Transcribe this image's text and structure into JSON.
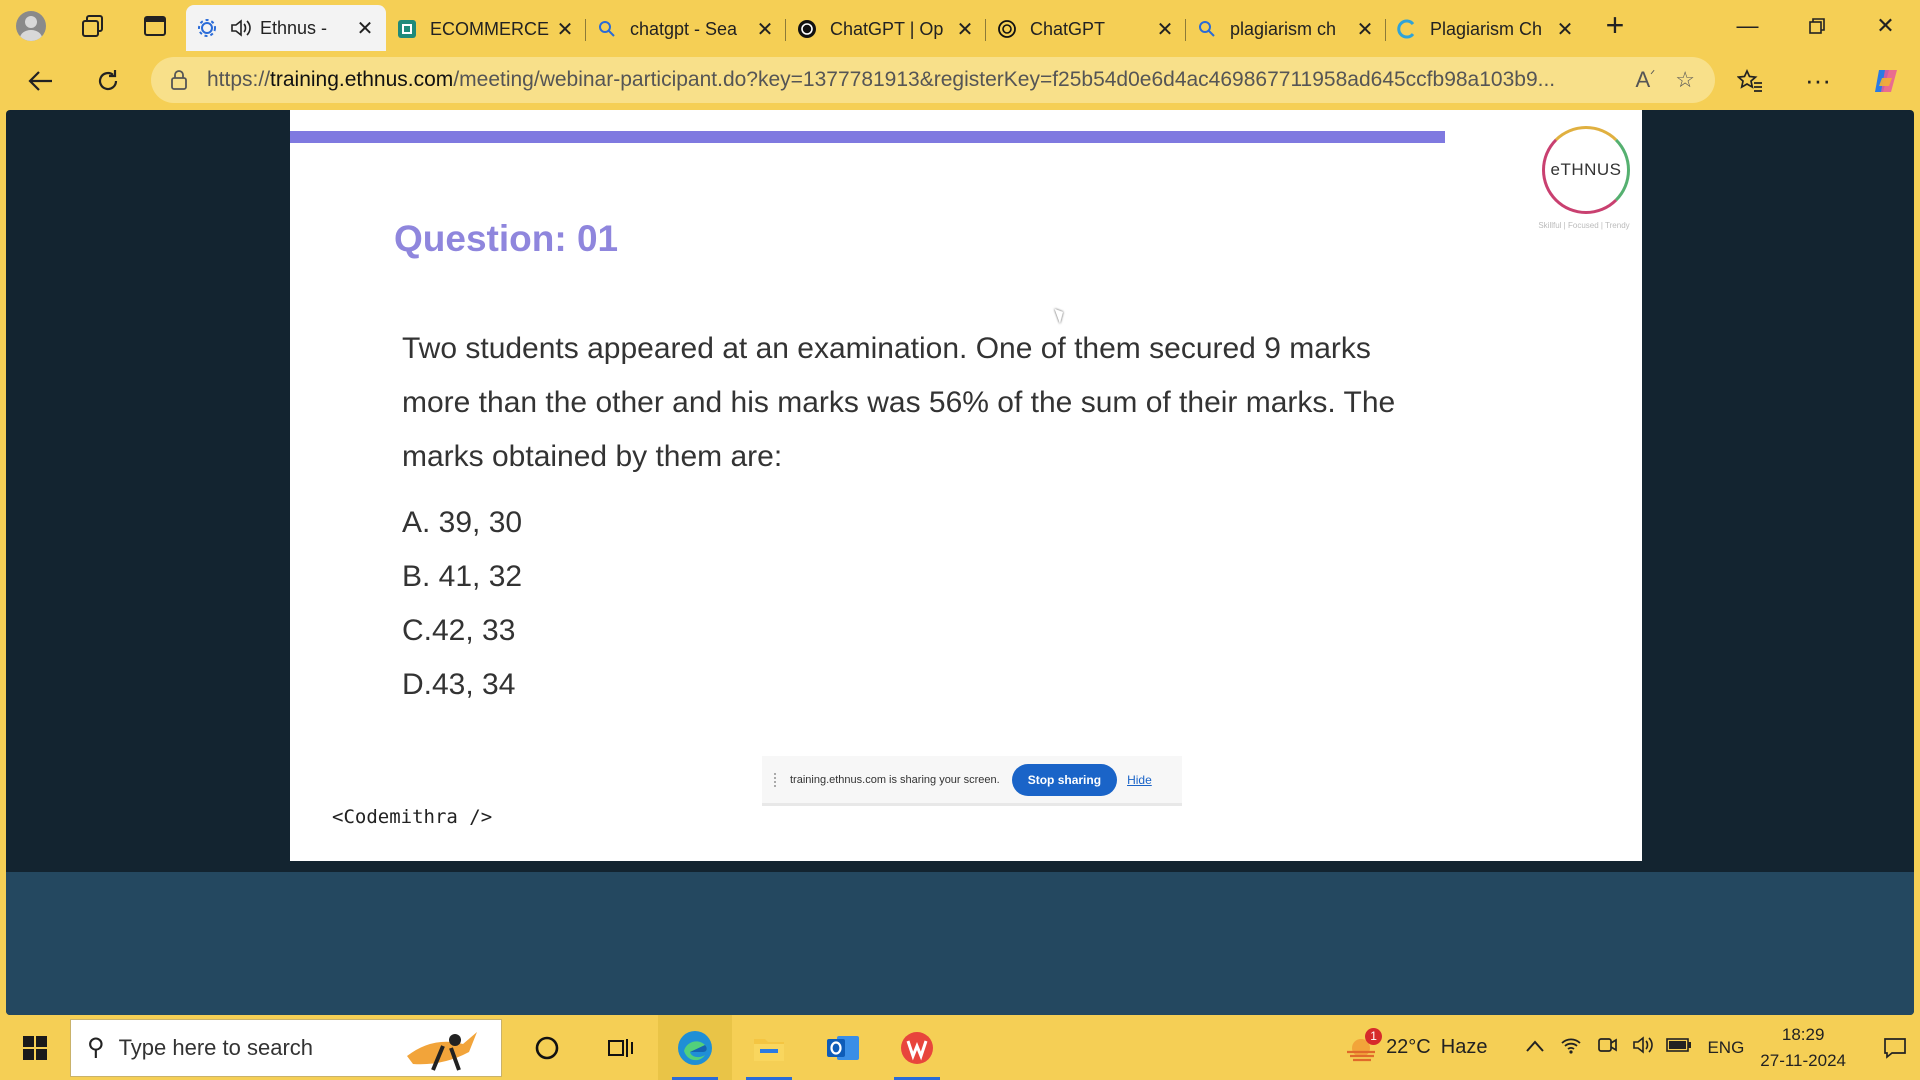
{
  "browser": {
    "tabs": [
      {
        "label": "Ethnus -",
        "icon": "ethnus-gear-icon",
        "active": true,
        "audio": true
      },
      {
        "label": "ECOMMERCE",
        "icon": "ecommerce-site-icon"
      },
      {
        "label": "chatgpt - Sea",
        "icon": "bing-search-icon"
      },
      {
        "label": "ChatGPT | Op",
        "icon": "openai-icon"
      },
      {
        "label": "ChatGPT",
        "icon": "openai-icon"
      },
      {
        "label": "plagiarism ch",
        "icon": "bing-search-icon"
      },
      {
        "label": "Plagiarism Ch",
        "icon": "plagiarism-site-icon"
      }
    ],
    "url_prefix": "https://",
    "url_domain": "training.ethnus.com",
    "url_rest": "/meeting/webinar-participant.do?key=1377781913&registerKey=f25b54d0e6d4ac469867711958ad645ccfb98a103b9..."
  },
  "slide": {
    "logo_text": "eTHNUS",
    "logo_tagline": "Skillful | Focused | Trendy",
    "question_title": "Question: 01",
    "question_text": "Two students appeared at an examination. One of them secured 9 marks more than the other and his marks was 56% of the sum of their marks. The marks obtained by them are:",
    "options": [
      "A. 39, 30",
      "B. 41, 32",
      "C.42, 33",
      "D.43, 34"
    ],
    "footer_brand": "<Codemithra />"
  },
  "share_bar": {
    "message": "training.ethnus.com is sharing your screen.",
    "stop_label": "Stop sharing",
    "hide_label": "Hide"
  },
  "taskbar": {
    "search_placeholder": "Type here to search",
    "weather_temp": "22°C",
    "weather_desc": "Haze",
    "weather_badge": "1",
    "language": "ENG",
    "time": "18:29",
    "date": "27-11-2024"
  },
  "colors": {
    "chrome": "#f5cf55",
    "slide_accent": "#7f79e0",
    "question_title": "#8f86dd",
    "stop_button": "#1a64c8"
  }
}
